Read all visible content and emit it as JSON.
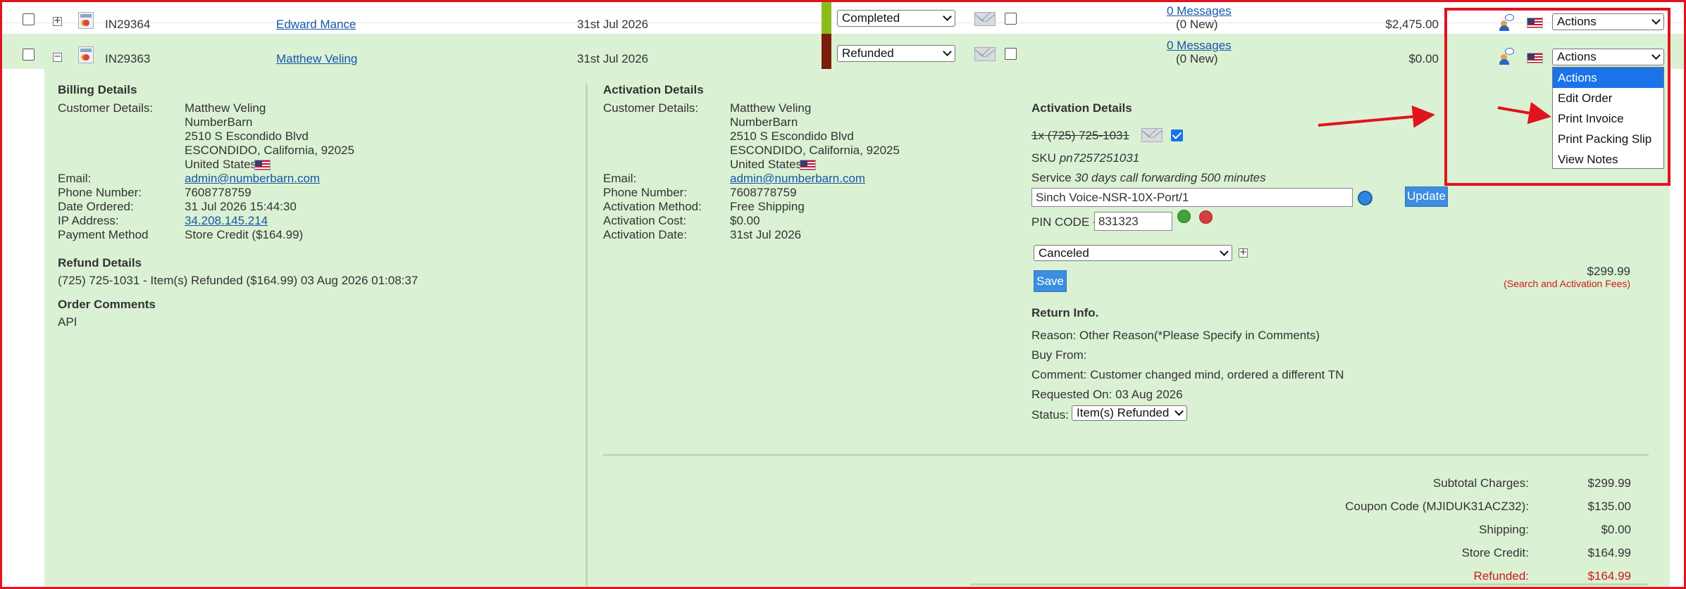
{
  "orders": [
    {
      "invoice": "IN29364",
      "customer": "Edward Mance",
      "date": "31st Jul 2026",
      "status": "Completed",
      "status_color": "#8cbb1e",
      "messages": "0 Messages",
      "new_messages": "(0 New)",
      "total": "$2,475.00",
      "action": "Actions"
    },
    {
      "invoice": "IN29363",
      "customer": "Matthew Veling",
      "date": "31st Jul 2026",
      "status": "Refunded",
      "status_color": "#7a1d0a",
      "messages": "0 Messages",
      "new_messages": "(0 New)",
      "total": "$0.00",
      "action": "Actions"
    }
  ],
  "actions_menu": [
    "Actions",
    "Edit Order",
    "Print Invoice",
    "Print Packing Slip",
    "View Notes"
  ],
  "billing": {
    "title": "Billing Details",
    "customer_label": "Customer Details:",
    "address": [
      "Matthew Veling",
      "NumberBarn",
      "2510 S Escondido Blvd",
      "ESCONDIDO, California, 92025",
      "United States"
    ],
    "fields": [
      {
        "label": "Email:",
        "value": "admin@numberbarn.com",
        "link": true
      },
      {
        "label": "Phone Number:",
        "value": "7608778759"
      },
      {
        "label": "Date Ordered:",
        "value": "31 Jul 2026 15:44:30"
      },
      {
        "label": "IP Address:",
        "value": "34.208.145.214",
        "link": true
      },
      {
        "label": "Payment Method",
        "value": "Store Credit ($164.99)"
      }
    ],
    "refund_title": "Refund Details",
    "refund_text": "(725) 725-1031 - Item(s) Refunded ($164.99) 03 Aug 2026 01:08:37",
    "comments_title": "Order Comments",
    "comments_text": "API"
  },
  "activation": {
    "title": "Activation Details",
    "customer_label": "Customer Details:",
    "address": [
      "Matthew Veling",
      "NumberBarn",
      "2510 S Escondido Blvd",
      "ESCONDIDO, California, 92025",
      "United States"
    ],
    "fields": [
      {
        "label": "Email:",
        "value": "admin@numberbarn.com",
        "link": true
      },
      {
        "label": "Phone Number:",
        "value": "7608778759"
      },
      {
        "label": "Activation Method:",
        "value": "Free Shipping"
      },
      {
        "label": "Activation Cost:",
        "value": "$0.00"
      },
      {
        "label": "Activation Date:",
        "value": "31st Jul 2026"
      }
    ]
  },
  "item": {
    "title": "Activation Details",
    "qty_number": "1x (725) 725-1031",
    "sku_label": "SKU",
    "sku": "pn7257251031",
    "service_label": "Service",
    "service": "30 days call forwarding 500 minutes",
    "carrier_value": "Sinch Voice-NSR-10X-Port/1",
    "update_label": "Update",
    "pin_label": "PIN CODE -",
    "pin_value": "831323",
    "item_status": "Canceled",
    "save_label": "Save",
    "price": "$299.99",
    "fees_note": "(Search and Activation Fees)"
  },
  "return_info": {
    "title": "Return Info.",
    "reason": "Reason: Other Reason(*Please Specify in Comments)",
    "buy_from": "Buy From:",
    "comment": "Comment: Customer changed mind, ordered a different TN",
    "requested": "Requested On: 03 Aug 2026",
    "status_label": "Status:",
    "status_value": "Item(s) Refunded"
  },
  "totals": [
    {
      "label": "Subtotal Charges:",
      "value": "$299.99"
    },
    {
      "label": "Coupon Code (MJIDUK31ACZ32):",
      "value": "$135.00"
    },
    {
      "label": "Shipping:",
      "value": "$0.00"
    },
    {
      "label": "Store Credit:",
      "value": "$164.99"
    },
    {
      "label": "Refunded:",
      "value": "$164.99",
      "red": true
    }
  ],
  "colors": {
    "expanded_bg": "#dbf1d4",
    "annotation_red": "#e0141e",
    "accent_blue": "#1a73e8"
  }
}
